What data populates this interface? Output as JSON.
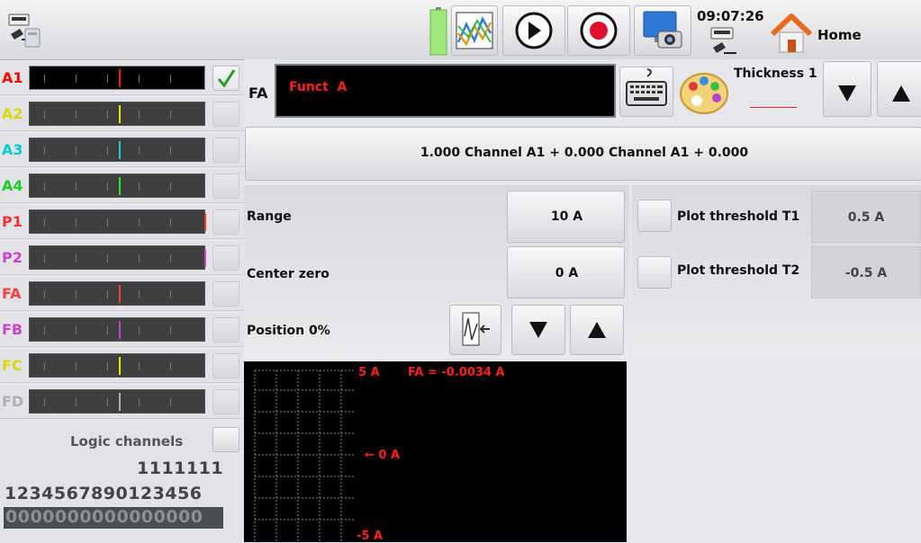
{
  "header": {
    "time": "09:07:26",
    "home_label": "Home",
    "icons": [
      "usb-storage-icon",
      "battery-icon",
      "chart-view-icon",
      "play-icon",
      "record-icon",
      "screenshot-icon",
      "usb-key-icon",
      "home-icon"
    ]
  },
  "channels": [
    {
      "label": "A1",
      "color": "#ff0000",
      "marker": "#ff2020",
      "active": true
    },
    {
      "label": "A2",
      "color": "#d9d900",
      "marker": "#e6e600",
      "active": false
    },
    {
      "label": "A3",
      "color": "#00cccc",
      "marker": "#20c8d8",
      "active": false
    },
    {
      "label": "A4",
      "color": "#22cc22",
      "marker": "#30e030",
      "active": false
    },
    {
      "label": "P1",
      "color": "#ff3030",
      "marker": "#ff3030",
      "active": false
    },
    {
      "label": "P2",
      "color": "#d040d0",
      "marker": "#d040d0",
      "active": false
    },
    {
      "label": "FA",
      "color": "#ff4040",
      "marker": "#ff4040",
      "active": false
    },
    {
      "label": "FB",
      "color": "#cc44cc",
      "marker": "#cc44cc",
      "active": false
    },
    {
      "label": "FC",
      "color": "#d9d900",
      "marker": "#e6e600",
      "active": false
    },
    {
      "label": "FD",
      "color": "#b0b0b0",
      "marker": "#b0b0b0",
      "active": false
    }
  ],
  "logic": {
    "title": "Logic channels",
    "row1": "1111111",
    "row2": "1234567890123456",
    "row3": "0000000000000000"
  },
  "function": {
    "tag": "FA",
    "name": "Funct  A",
    "thickness_label": "Thickness 1",
    "formula": "1.000 Channel A1 + 0.000 Channel A1 + 0.000"
  },
  "settings": {
    "range_label": "Range",
    "range_value": "10 A",
    "center_label": "Center zero",
    "center_value": "0 A",
    "position_label": "Position 0%"
  },
  "thresholds": [
    {
      "label": "Plot threshold T1",
      "value": "0.5 A"
    },
    {
      "label": "Plot threshold T2",
      "value": "-0.5 A"
    }
  ],
  "scope": {
    "top_label": "5 A",
    "readout": "FA = -0.0034 A",
    "zero_label": "← 0 A",
    "bottom_label": "-5 A"
  }
}
